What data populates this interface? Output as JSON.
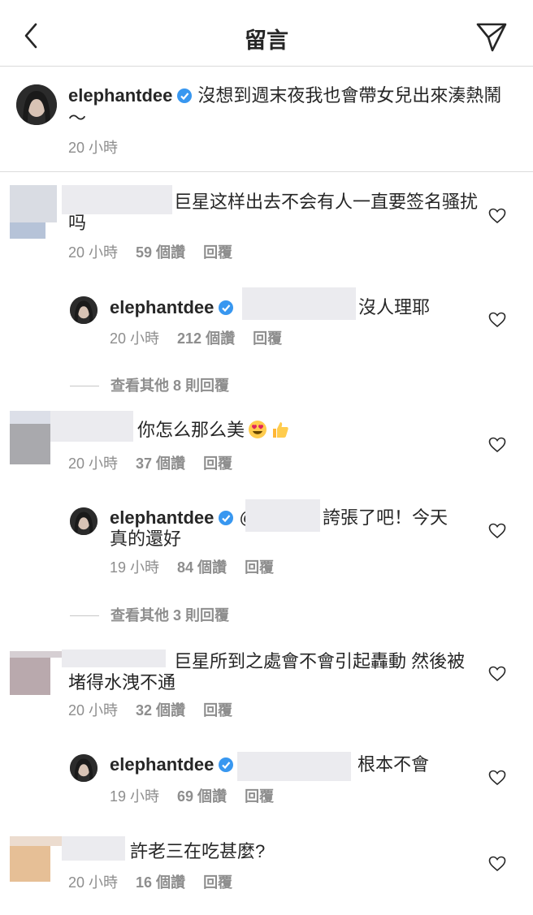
{
  "header": {
    "title": "留言"
  },
  "caption": {
    "username": "elephantdee",
    "text": "沒想到週末夜我也會帶女兒出來湊熱鬧～",
    "time": "20 小時"
  },
  "comments": [
    {
      "text": "巨星这样出去不会有人一直要签名骚扰吗",
      "time": "20 小時",
      "likes": "59 個讚",
      "reply_label": "回覆",
      "reply": {
        "username": "elephantdee",
        "text": "沒人理耶",
        "time": "20 小時",
        "likes": "212 個讚",
        "reply_label": "回覆"
      },
      "more": "查看其他 8 則回覆"
    },
    {
      "text": "你怎么那么美",
      "time": "20 小時",
      "likes": "37 個讚",
      "reply_label": "回覆",
      "reply": {
        "username": "elephantdee",
        "mention_prefix": "@",
        "text": "誇張了吧！今天真的還好",
        "time": "19 小時",
        "likes": "84 個讚",
        "reply_label": "回覆"
      },
      "more": "查看其他 3 則回覆"
    },
    {
      "text": "巨星所到之處會不會引起轟動 然後被堵得水洩不通",
      "time": "20 小時",
      "likes": "32 個讚",
      "reply_label": "回覆",
      "reply": {
        "username": "elephantdee",
        "text": "根本不會",
        "time": "19 小時",
        "likes": "69 個讚",
        "reply_label": "回覆"
      }
    },
    {
      "text": "許老三在吃甚麼?",
      "time": "20 小時",
      "likes": "16 個讚",
      "reply_label": "回覆"
    }
  ],
  "icons": {
    "back": "chevron-left-icon",
    "send": "paper-plane-icon",
    "verified": "verified-badge-icon",
    "like": "heart-outline-icon"
  },
  "colors": {
    "verified": "#3897f0",
    "muted": "#8e8e8e",
    "text": "#262626",
    "divider": "#dbdbdb"
  }
}
